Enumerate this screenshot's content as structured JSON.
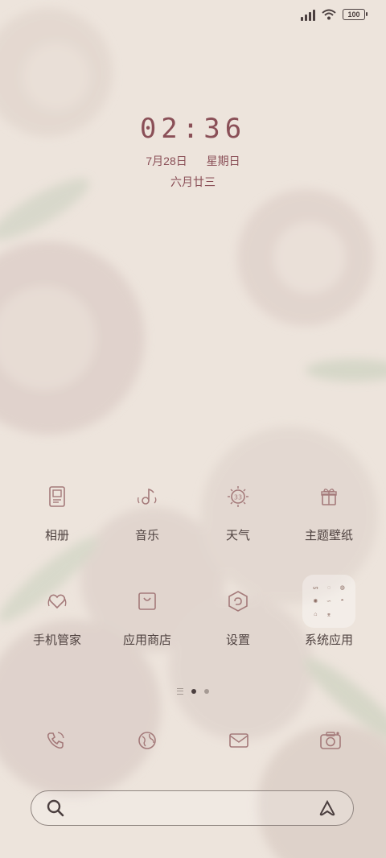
{
  "status_bar": {
    "battery": "100",
    "signal_icon": "signal-icon",
    "wifi_icon": "wifi-icon"
  },
  "lockclock": {
    "time": "02:36",
    "date": "7月28日",
    "weekday": "星期日",
    "lunar": "六月廿三"
  },
  "apps": [
    {
      "label": "相册",
      "icon": "album-icon"
    },
    {
      "label": "音乐",
      "icon": "music-icon"
    },
    {
      "label": "天气",
      "icon": "weather-icon",
      "badge": "33"
    },
    {
      "label": "主题壁纸",
      "icon": "theme-icon"
    },
    {
      "label": "手机管家",
      "icon": "security-icon"
    },
    {
      "label": "应用商店",
      "icon": "store-icon"
    },
    {
      "label": "设置",
      "icon": "settings-icon"
    },
    {
      "label": "系统应用",
      "icon": "folder-icon"
    }
  ],
  "dock": [
    {
      "icon": "phone-icon"
    },
    {
      "icon": "browser-icon"
    },
    {
      "icon": "messages-icon"
    },
    {
      "icon": "camera-icon"
    }
  ],
  "colors": {
    "background": "#ede4dc",
    "accent": "#8a4f57",
    "text": "#4f4240"
  }
}
